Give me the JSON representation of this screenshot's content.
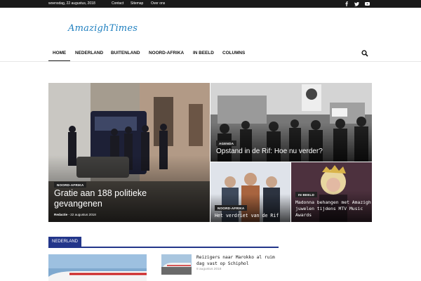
{
  "topbar": {
    "date": "woensdag, 22 augustus, 2018",
    "links": [
      "Contact",
      "Sitemap",
      "Over ons"
    ],
    "social_icons": [
      "facebook-icon",
      "twitter-icon",
      "youtube-icon"
    ]
  },
  "logo": {
    "text": "AmazighTimes"
  },
  "nav": {
    "items": [
      "HOME",
      "NEDERLAND",
      "BUITENLAND",
      "NOORD-AFRIKA",
      "IN BEELD",
      "COLUMNS"
    ],
    "active": "HOME"
  },
  "featured": [
    {
      "category": "NOORD-AFRIKA",
      "title": "Gratie aan 188 politieke gevangenen",
      "author": "Redactie",
      "date": "22 augustus 2018"
    },
    {
      "category": "AGENDA",
      "title": "Opstand in de Rif: Hoe nu verder?"
    },
    {
      "category": "NOORD-AFRIKA",
      "title": "Het verdriet van de Rif"
    },
    {
      "category": "IN BEELD",
      "title": "Madonna behangen met Amazigh juwelen tijdens MTV Music Awards"
    }
  ],
  "section": {
    "label": "NEDERLAND",
    "list_item": {
      "title": "Reizigers naar Marokko al ruim dag vast op Schiphol",
      "date": "8 augustus 2018"
    }
  },
  "colors": {
    "brand": "#1e7fbf",
    "section_accent": "#23368a",
    "topbar": "#1a1a1a"
  }
}
